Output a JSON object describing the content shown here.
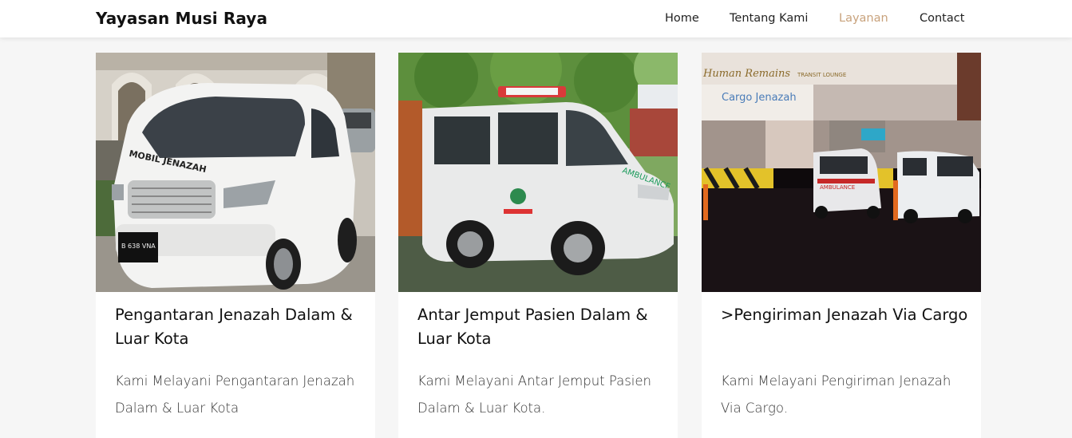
{
  "brand": {
    "name": "Yayasan Musi Raya"
  },
  "nav": {
    "items": [
      {
        "label": "Home"
      },
      {
        "label": "Tentang Kami"
      },
      {
        "label": "Layanan"
      },
      {
        "label": "Contact"
      }
    ],
    "active_color": "#c8a27c"
  },
  "cards": [
    {
      "image_icon": "white-minivan-hearse-photo",
      "image_text": {
        "car_side": "MOBIL JENAZAH",
        "plate": "B 638 VNA"
      },
      "title": "Pengantaran Jenazah Dalam & Luar Kota",
      "text": "Kami Melayani Pengantaran Jenazah Dalam & Luar Kota"
    },
    {
      "image_icon": "white-ambulance-van-photo",
      "title": "Antar Jemput Pasien Dalam & Luar Kota",
      "text": "Kami Melayani Antar Jemput Pasien Dalam & Luar Kota."
    },
    {
      "image_icon": "airport-cargo-terminal-photo",
      "image_text": {
        "sign_top": "Human Remains",
        "sign_sub": "TRANSIT LOUNGE",
        "sign_cargo": "Cargo Jenazah",
        "ambulance": "AMBULANCE"
      },
      "title": ">Pengiriman Jenazah Via Cargo",
      "text": "Kami Melayani Pengiriman Jenazah Via Cargo."
    }
  ]
}
